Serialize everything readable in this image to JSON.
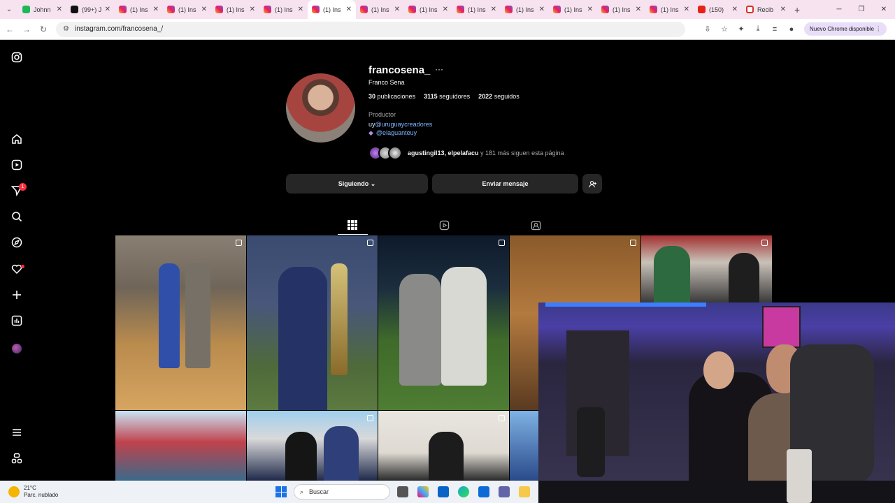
{
  "browser": {
    "tabs": [
      {
        "title": "Johnn",
        "favicon": "kick-icon",
        "active": false
      },
      {
        "title": "(99+) J",
        "favicon": "tiktok-icon",
        "active": false
      },
      {
        "title": "(1) Ins",
        "favicon": "instagram-icon",
        "active": false
      },
      {
        "title": "(1) Ins",
        "favicon": "instagram-icon",
        "active": false
      },
      {
        "title": "(1) Ins",
        "favicon": "instagram-icon",
        "active": false
      },
      {
        "title": "(1) Ins",
        "favicon": "instagram-icon",
        "active": false
      },
      {
        "title": "(1) Ins",
        "favicon": "instagram-icon",
        "active": true
      },
      {
        "title": "(1) Ins",
        "favicon": "instagram-icon",
        "active": false
      },
      {
        "title": "(1) Ins",
        "favicon": "instagram-icon",
        "active": false
      },
      {
        "title": "(1) Ins",
        "favicon": "instagram-icon",
        "active": false
      },
      {
        "title": "(1) Ins",
        "favicon": "instagram-icon",
        "active": false
      },
      {
        "title": "(1) Ins",
        "favicon": "instagram-icon",
        "active": false
      },
      {
        "title": "(1) Ins",
        "favicon": "instagram-icon",
        "active": false
      },
      {
        "title": "(1) Ins",
        "favicon": "instagram-icon",
        "active": false
      },
      {
        "title": "(150)",
        "favicon": "youtube-icon",
        "active": false
      },
      {
        "title": "Recib",
        "favicon": "gmail-icon",
        "active": false
      }
    ],
    "url": "instagram.com/francosena_/",
    "update_label": "Nuevo Chrome disponible"
  },
  "profile": {
    "username": "francosena_",
    "full_name": "Franco Sena",
    "posts_count": "30",
    "posts_label": "publicaciones",
    "followers_count": "3115",
    "followers_label": "seguidores",
    "following_count": "2022",
    "following_label": "seguidos",
    "category": "Productor",
    "bio_links": [
      {
        "prefix": "uy",
        "handle": "@uruguaycreadores"
      },
      {
        "prefix": "",
        "handle": "@elaguanteuy"
      }
    ],
    "followed_by_names": "agustingil13, elpelafacu",
    "followed_by_rest": " y 181 más siguen esta página"
  },
  "actions": {
    "following_label": "Siguiendo",
    "message_label": "Enviar mensaje"
  },
  "taskbar": {
    "temperature": "21°C",
    "weather": "Parc. nublado",
    "search_placeholder": "Buscar"
  },
  "colors": {
    "accent_link": "#7eb6ff",
    "notification": "#ff3040",
    "button_bg": "#262626"
  }
}
